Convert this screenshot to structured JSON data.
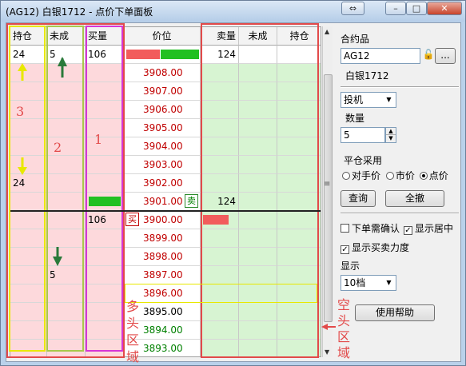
{
  "window": {
    "title": "(AG12) 白银1712 - 点价下单面板"
  },
  "grid": {
    "headers": [
      "持仓",
      "未成",
      "买量",
      "价位",
      "卖量",
      "未成",
      "持仓"
    ],
    "top_row": {
      "pos": "24",
      "unfilled": "5",
      "buy_vol": "106",
      "sell_vol": "124"
    },
    "prices": [
      "3908.00",
      "3907.00",
      "3906.00",
      "3905.00",
      "3904.00",
      "3903.00",
      "3902.00",
      "3901.00",
      "3900.00",
      "3899.00",
      "3898.00",
      "3897.00",
      "3896.00",
      "3895.00",
      "3894.00",
      "3893.00"
    ],
    "row_3902_pos": "24",
    "row_3901_sell_vol": "124",
    "row_3900_buy_vol": "106",
    "row_3897_unfilled": "5",
    "sell_tag": "卖",
    "buy_tag": "买"
  },
  "annotations": {
    "label_1": "1",
    "label_2": "2",
    "label_3": "3",
    "long_zone": "多头区域",
    "short_zone": "空头区域"
  },
  "panel": {
    "contract_label": "合约品",
    "contract_code": "AG12",
    "browse": "...",
    "contract_name": "白银1712",
    "order_type": "投机",
    "qty_label": "数量",
    "qty_value": "5",
    "close_label": "平仓采用",
    "close_opts": [
      "对手价",
      "市价",
      "点价"
    ],
    "query_btn": "查询",
    "cancel_all_btn": "全撤",
    "confirm_chk": "下单需确认",
    "center_chk": "显示居中",
    "strength_chk": "显示买卖力度",
    "display_label": "显示",
    "display_value": "10档",
    "help_btn": "使用帮助"
  },
  "colors": {
    "buy_bar": "#f25c5c",
    "sell_bar": "#22c022",
    "pink": "#fdd9dc",
    "green": "#d7f4d2"
  }
}
